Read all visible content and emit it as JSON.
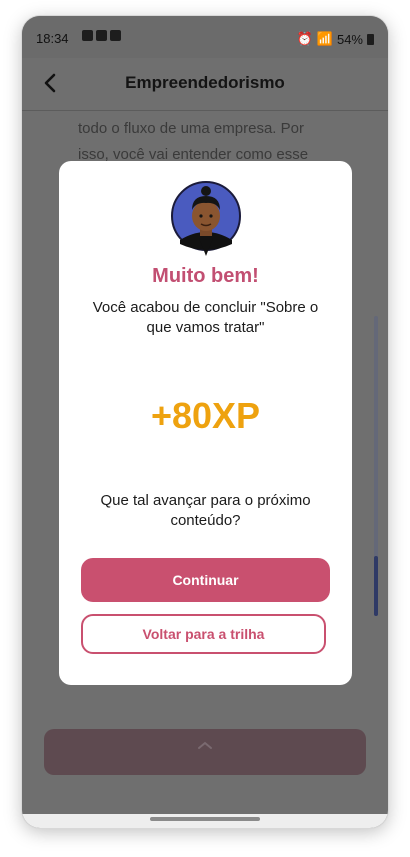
{
  "status_bar": {
    "time": "18:34",
    "battery": "54%"
  },
  "app_bar": {
    "title": "Empreendedorismo"
  },
  "background": {
    "lines": [
      "todo o fluxo de uma empresa. Por",
      "isso, você vai entender como esse"
    ]
  },
  "modal": {
    "title": "Muito bem!",
    "message": "Você acabou de concluir \"Sobre o que vamos tratar\"",
    "xp": "+80XP",
    "question": "Que tal avançar para o próximo conteúdo?",
    "primary_button": "Continuar",
    "secondary_button": "Voltar para a trilha"
  },
  "colors": {
    "accent": "#c9506f",
    "title": "#c24f72",
    "xp": "#eea20f",
    "overlay": "#6f6f6f"
  },
  "icons": [
    "back-arrow-icon",
    "chevron-up-icon",
    "avatar-icon"
  ]
}
